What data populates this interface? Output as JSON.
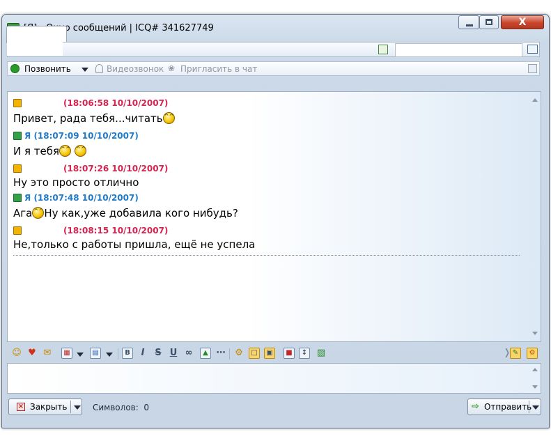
{
  "window": {
    "title": "[Я] - Окно сообщений | ICQ# 341627749",
    "close_symbol": "X"
  },
  "toolbar": {
    "call_label": "Позвонить",
    "video_label": "Видеозвонок",
    "invite_label": "Пригласить в чат"
  },
  "messages": [
    {
      "sender": "them",
      "time": "(18:06:58 10/10/2007)",
      "text": "Привет, рада тебя...читать"
    },
    {
      "sender": "me",
      "author": "Я",
      "time": "(18:07:09 10/10/2007)",
      "text": "И я тебя"
    },
    {
      "sender": "them",
      "time": "(18:07:26 10/10/2007)",
      "text": "Ну это просто отлично"
    },
    {
      "sender": "me",
      "author": "Я",
      "time": "(18:07:48 10/10/2007)",
      "text_before": "Ага",
      "text_after": "Ну как,уже добавила кого нибудь?"
    },
    {
      "sender": "them",
      "time": "(18:08:15 10/10/2007)",
      "text": "Не,только с работы пришла, ещё не успела"
    }
  ],
  "format_bar": {
    "bold": "B",
    "italic": "I",
    "strike": "S",
    "underline": "U"
  },
  "footer": {
    "close_label": "Закрыть",
    "chars_label": "Символов:",
    "chars_count": "0",
    "send_label": "Отправить"
  },
  "colors": {
    "incoming_header": "#d5234f",
    "outgoing_header": "#1f7ac9"
  },
  "icons": [
    "window-icon",
    "minimize-icon",
    "maximize-icon",
    "close-icon",
    "contact-info-icon",
    "card-icon",
    "phone-icon",
    "video-icon",
    "invite-icon",
    "collapse-icon",
    "smiley-icon",
    "dropdown-arrow-icon",
    "send-arrow-icon",
    "close-x-icon"
  ]
}
